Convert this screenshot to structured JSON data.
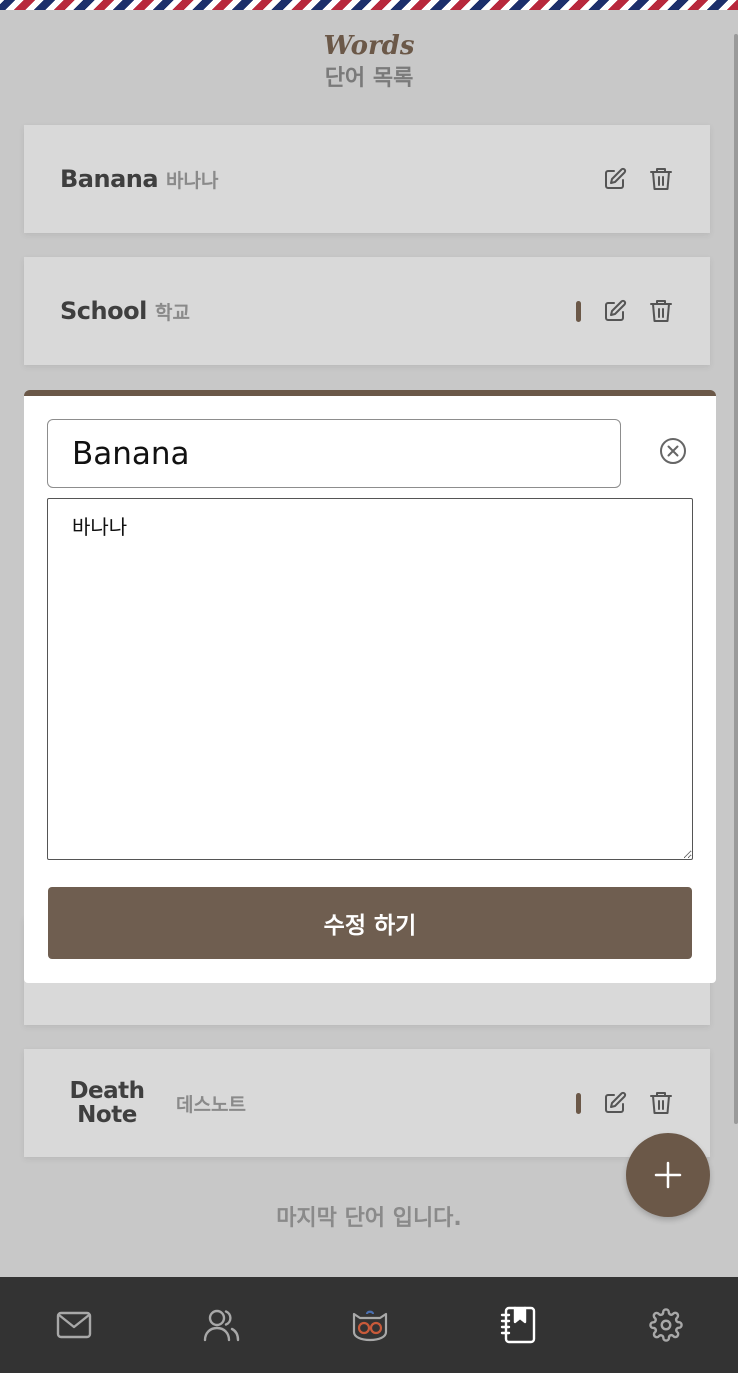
{
  "header": {
    "title": "Words",
    "subtitle": "단어 목록"
  },
  "words": [
    {
      "word": "Banana",
      "meaning": "바나나"
    },
    {
      "word": "School",
      "meaning": "학교"
    },
    {
      "word": "Death Note",
      "word_lines": [
        "Death",
        "Note"
      ],
      "meaning": "데스노트"
    }
  ],
  "editor": {
    "word_value": "Banana",
    "meaning_value": "바나나",
    "submit_label": "수정 하기"
  },
  "footer_text": "마지막 단어 입니다.",
  "nav": {
    "items": [
      "mail-icon",
      "friends-icon",
      "owl-icon",
      "word-book-icon",
      "settings-icon"
    ],
    "active": "word-book-icon"
  },
  "colors": {
    "accent": "#6b5848",
    "background": "#c8c8c8",
    "card": "#d9d9d9",
    "nav_bar": "#333333"
  }
}
